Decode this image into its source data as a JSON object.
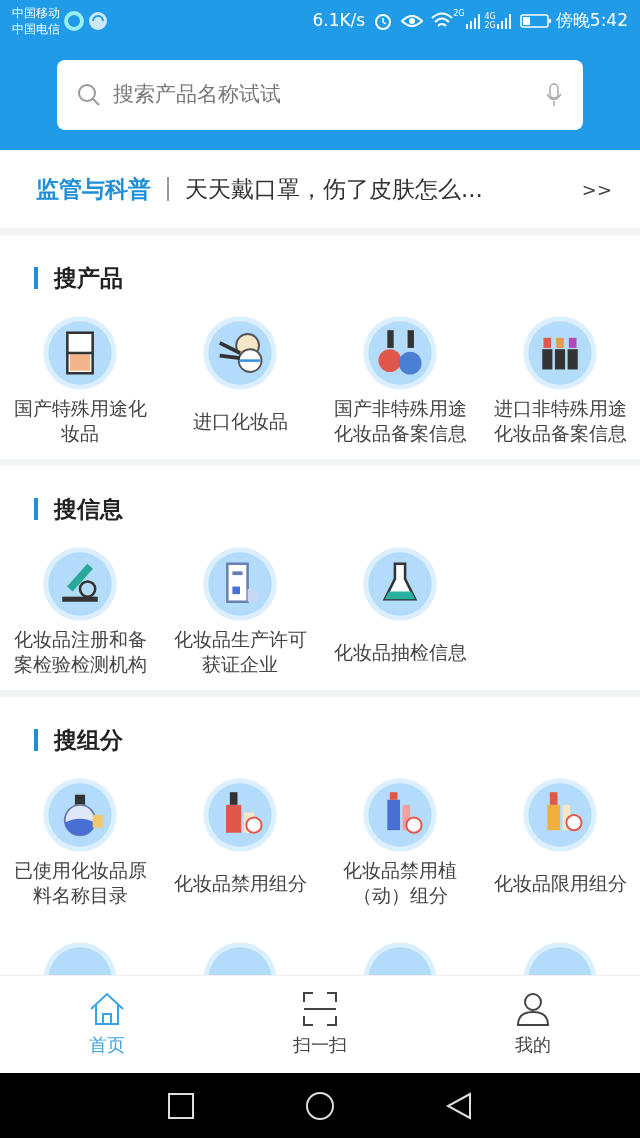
{
  "status_bar": {
    "carrier_1": "中国移动",
    "carrier_2": "中国电信",
    "speed": "6.1K/s",
    "network_1": "2G",
    "network_2": "4G",
    "network_3": "2G",
    "time": "傍晚5:42"
  },
  "search": {
    "placeholder": "搜索产品名称试试"
  },
  "notice": {
    "label": "监管与科普",
    "text": "天天戴口罩，伤了皮肤怎么...",
    "more": ">>"
  },
  "sections": [
    {
      "title": "搜产品",
      "items": [
        {
          "label": "国产特殊用途化妆品",
          "kind": "compact"
        },
        {
          "label": "进口化妆品",
          "kind": "brushes"
        },
        {
          "label": "国产非特殊用途化妆品备案信息",
          "kind": "polish"
        },
        {
          "label": "进口非特殊用途化妆品备案信息",
          "kind": "lipsticks"
        }
      ]
    },
    {
      "title": "搜信息",
      "items": [
        {
          "label": "化妆品注册和备案检验检测机构",
          "kind": "microscope"
        },
        {
          "label": "化妆品生产许可获证企业",
          "kind": "factory"
        },
        {
          "label": "化妆品抽检信息",
          "kind": "flask"
        }
      ]
    },
    {
      "title": "搜组分",
      "items": [
        {
          "label": "已使用化妆品原料名称目录",
          "kind": "bottle"
        },
        {
          "label": "化妆品禁用组分",
          "kind": "banned"
        },
        {
          "label": "化妆品禁用植（动）组分",
          "kind": "banned2"
        },
        {
          "label": "化妆品限用组分",
          "kind": "limited"
        },
        {
          "kind": "blank"
        },
        {
          "kind": "blank"
        },
        {
          "kind": "blank"
        },
        {
          "kind": "blank"
        }
      ]
    }
  ],
  "tabs": [
    {
      "label": "首页",
      "kind": "home",
      "selected": true
    },
    {
      "label": "扫一扫",
      "kind": "scan",
      "selected": false
    },
    {
      "label": "我的",
      "kind": "user",
      "selected": false
    }
  ]
}
